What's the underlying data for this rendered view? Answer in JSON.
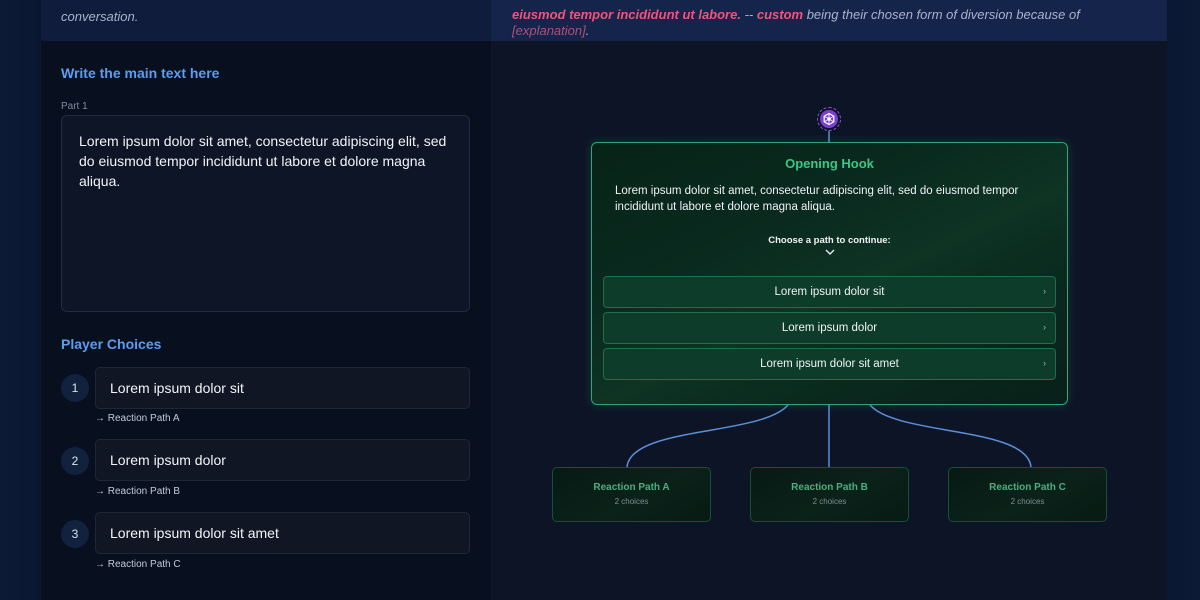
{
  "header": {
    "left_text": "conversation.",
    "right_line2": {
      "accent_text": "eiusmod tempor incididunt ut labore.",
      "separator": " -- ",
      "custom": "custom",
      "mid_text": " being their chosen form of diversion because of ",
      "explanation": "[explanation]",
      "end": "."
    }
  },
  "editor": {
    "main_title": "Write the main text here",
    "part_label": "Part 1",
    "main_text": "Lorem ipsum dolor sit amet, consectetur adipiscing elit, sed do eiusmod tempor incididunt ut labore et dolore magna aliqua.",
    "choices_title": "Player Choices",
    "choices": [
      {
        "number": "1",
        "text": "Lorem ipsum dolor sit",
        "path": "→ Reaction Path A"
      },
      {
        "number": "2",
        "text": "Lorem ipsum dolor",
        "path": "→ Reaction Path B"
      },
      {
        "number": "3",
        "text": "Lorem ipsum dolor sit amet",
        "path": "→ Reaction Path C"
      }
    ]
  },
  "preview": {
    "top_node_icon": "hexagon-gear-icon",
    "hook": {
      "title": "Opening Hook",
      "body": "Lorem ipsum dolor sit amet, consectetur adipiscing elit, sed do eiusmod tempor incididunt ut labore et dolore magna aliqua.",
      "prompt": "Choose a path to continue:",
      "buttons": [
        {
          "label": "Lorem ipsum dolor sit",
          "arrow": "›"
        },
        {
          "label": "Lorem ipsum dolor",
          "arrow": "›"
        },
        {
          "label": "Lorem ipsum dolor sit amet",
          "arrow": "›"
        }
      ]
    },
    "reaction_nodes": [
      {
        "title": "Reaction Path A",
        "subtitle": "2 choices"
      },
      {
        "title": "Reaction Path B",
        "subtitle": "2 choices"
      },
      {
        "title": "Reaction Path C",
        "subtitle": "2 choices"
      }
    ]
  },
  "colors": {
    "accent_blue": "#5b9df0",
    "accent_green": "#38c885",
    "accent_pink": "#f0547d",
    "connector": "#5b8fd6"
  }
}
